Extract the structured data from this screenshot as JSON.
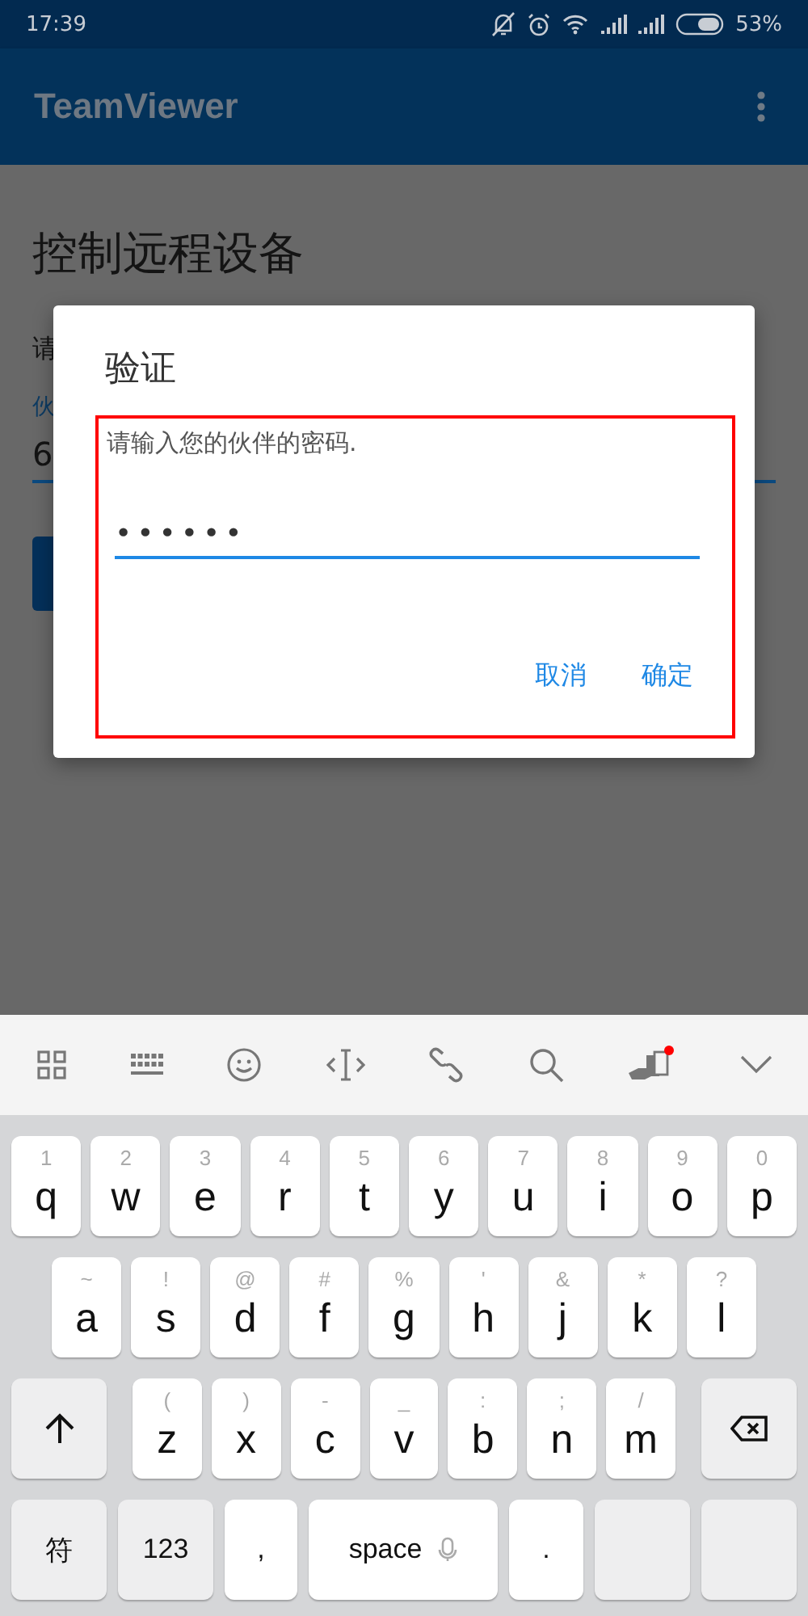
{
  "status_bar": {
    "time": "17:39",
    "battery": "53%"
  },
  "app_bar": {
    "title": "TeamViewer"
  },
  "page": {
    "heading": "控制远程设备",
    "label_1": "请",
    "label_2": "伙",
    "field_value": "6"
  },
  "dialog": {
    "title": "验证",
    "message": "请输入您的伙伴的密码.",
    "password": "••••••",
    "buttons": [
      "取消",
      "确定"
    ]
  },
  "keyboard": {
    "rows": [
      {
        "keys": [
          {
            "kind": "letter",
            "label": "q",
            "hint": "1"
          },
          {
            "kind": "letter",
            "label": "w",
            "hint": "2"
          },
          {
            "kind": "letter",
            "label": "e",
            "hint": "3"
          },
          {
            "kind": "letter",
            "label": "r",
            "hint": "4"
          },
          {
            "kind": "letter",
            "label": "t",
            "hint": "5"
          },
          {
            "kind": "letter",
            "label": "y",
            "hint": "6"
          },
          {
            "kind": "letter",
            "label": "u",
            "hint": "7"
          },
          {
            "kind": "letter",
            "label": "i",
            "hint": "8"
          },
          {
            "kind": "letter",
            "label": "o",
            "hint": "9"
          },
          {
            "kind": "letter",
            "label": "p",
            "hint": "0"
          }
        ]
      },
      {
        "keys": [
          {
            "kind": "letter",
            "label": "a",
            "hint": "~"
          },
          {
            "kind": "letter",
            "label": "s",
            "hint": "!"
          },
          {
            "kind": "letter",
            "label": "d",
            "hint": "@"
          },
          {
            "kind": "letter",
            "label": "f",
            "hint": "#"
          },
          {
            "kind": "letter",
            "label": "g",
            "hint": "%"
          },
          {
            "kind": "letter",
            "label": "h",
            "hint": "'"
          },
          {
            "kind": "letter",
            "label": "j",
            "hint": "&"
          },
          {
            "kind": "letter",
            "label": "k",
            "hint": "*"
          },
          {
            "kind": "letter",
            "label": "l",
            "hint": "?"
          }
        ]
      },
      {
        "keys": [
          {
            "kind": "shift"
          },
          {
            "kind": "letter",
            "label": "z",
            "hint": "("
          },
          {
            "kind": "letter",
            "label": "x",
            "hint": ")"
          },
          {
            "kind": "letter",
            "label": "c",
            "hint": "-"
          },
          {
            "kind": "letter",
            "label": "v",
            "hint": "_"
          },
          {
            "kind": "letter",
            "label": "b",
            "hint": ":"
          },
          {
            "kind": "letter",
            "label": "n",
            "hint": ";"
          },
          {
            "kind": "letter",
            "label": "m",
            "hint": "/"
          },
          {
            "kind": "backspace"
          }
        ]
      },
      {
        "keys": [
          {
            "kind": "function",
            "label": "符"
          },
          {
            "kind": "function",
            "label": "123"
          },
          {
            "kind": "plain",
            "label": ","
          },
          {
            "kind": "space",
            "label": "space"
          },
          {
            "kind": "plain",
            "label": "."
          },
          {
            "kind": "blank"
          },
          {
            "kind": "blank"
          }
        ]
      }
    ]
  }
}
